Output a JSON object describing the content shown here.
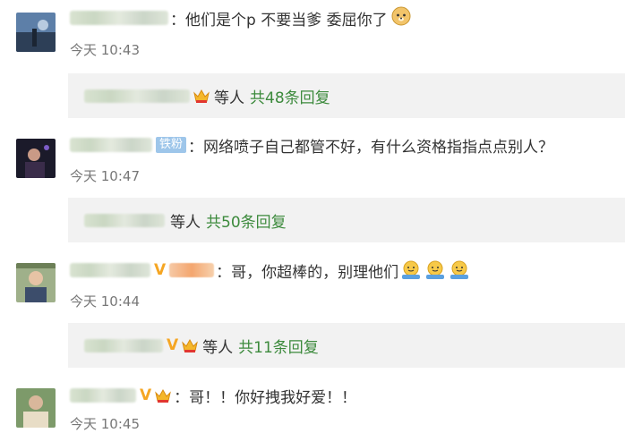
{
  "comments": [
    {
      "text": "：他们是个p 不要当爹 委屈你了",
      "time": "今天 10:43",
      "reply_others": "等人",
      "reply_count": "共48条回复"
    },
    {
      "badge": "铁粉",
      "text": "：网络喷子自己都管不好，有什么资格指指点点别人？",
      "time": "今天 10:47",
      "reply_others": "等人",
      "reply_count": "共50条回复"
    },
    {
      "text": "：哥，你超棒的，别理他们",
      "time": "今天 10:44",
      "reply_others": "等人",
      "reply_count": "共11条回复"
    },
    {
      "text": "：哥！！你好拽我好爱！！",
      "time": "今天 10:45"
    }
  ],
  "colors": {
    "link_green": "#3c8a3c",
    "reply_bg": "#f2f2f2",
    "vip_gold": "#f5a623"
  },
  "icons": [
    "doge-emoji",
    "crown-icon",
    "hug-emoji",
    "vip-v-icon"
  ]
}
